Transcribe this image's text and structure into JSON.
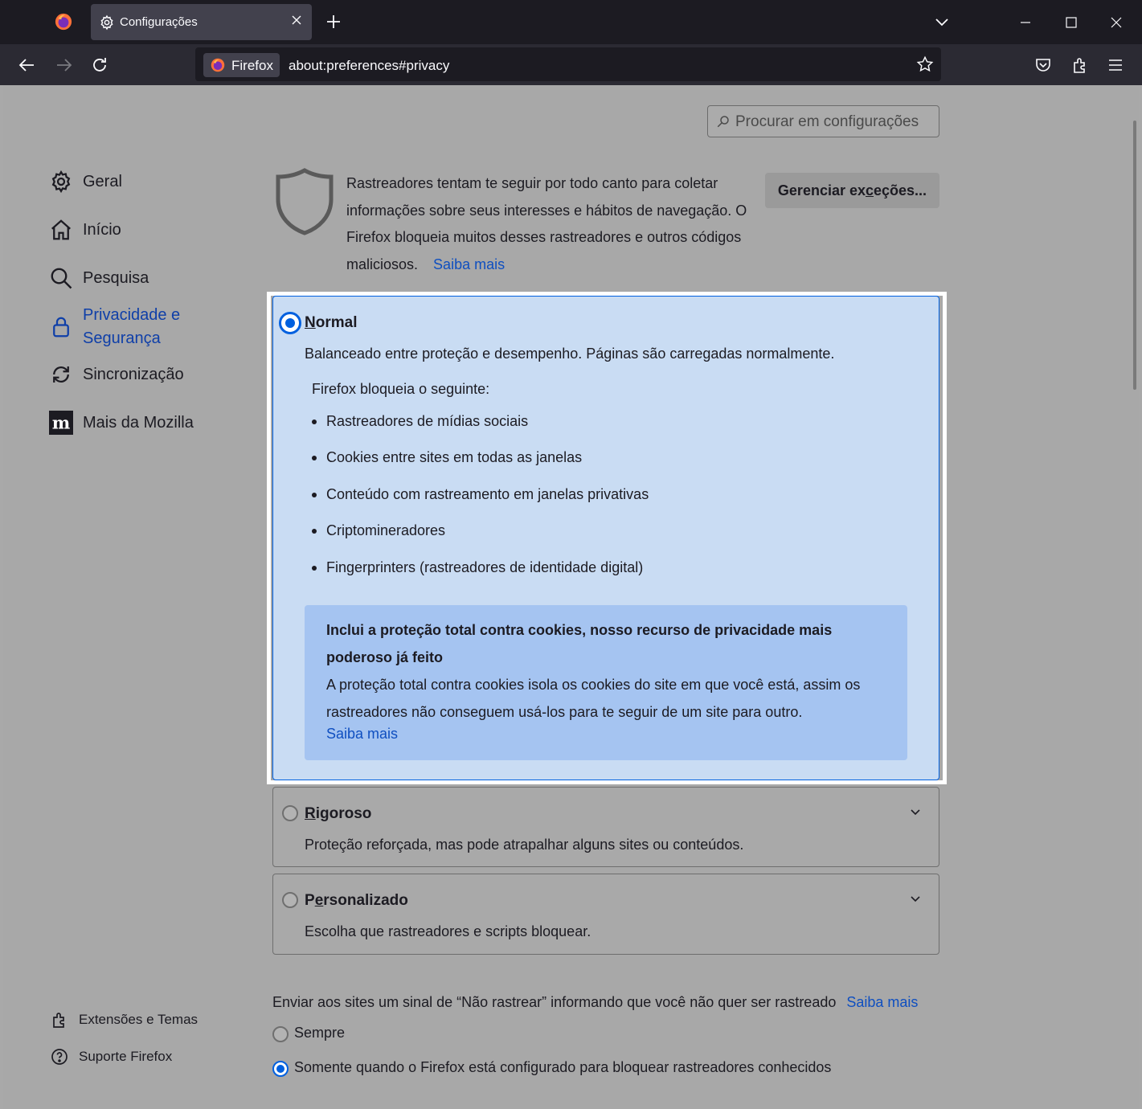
{
  "tab": {
    "title": "Configurações"
  },
  "urlbar": {
    "identity_label": "Firefox",
    "url": "about:preferences#privacy"
  },
  "search": {
    "placeholder": "Procurar em configurações"
  },
  "sidebar": {
    "items": [
      {
        "label": "Geral"
      },
      {
        "label": "Início"
      },
      {
        "label": "Pesquisa"
      },
      {
        "label_line1": "Privacidade e",
        "label_line2": "Segurança"
      },
      {
        "label": "Sincronização"
      },
      {
        "label": "Mais da Mozilla"
      }
    ],
    "footer": [
      {
        "label": "Extensões e Temas"
      },
      {
        "label": "Suporte Firefox"
      }
    ]
  },
  "tracking": {
    "intro": "Rastreadores tentam te seguir por todo canto para coletar informações sobre seus interesses e hábitos de navegação. O Firefox bloqueia muitos desses rastreadores e outros códigos maliciosos.",
    "learn_more": "Saiba mais",
    "manage_label_pre": "Gerenciar ex",
    "manage_label_key": "c",
    "manage_label_post": "eções..."
  },
  "normal": {
    "title_key": "N",
    "title_rest": "ormal",
    "description": "Balanceado entre proteção e desempenho. Páginas são carregadas normalmente.",
    "blocks_heading": "Firefox bloqueia o seguinte:",
    "blocks": [
      "Rastreadores de mídias sociais",
      "Cookies entre sites em todas as janelas",
      "Conteúdo com rastreamento em janelas privativas",
      "Criptomineradores",
      "Fingerprinters (rastreadores de identidade digital)"
    ],
    "tcp_title": "Inclui a proteção total contra cookies, nosso recurso de privacidade mais poderoso já feito",
    "tcp_body": "A proteção total contra cookies isola os cookies do site em que você está, assim os rastreadores não conseguem usá-los para te seguir de um site para outro.",
    "tcp_link": "Saiba mais"
  },
  "strict": {
    "title_key": "R",
    "title_rest": "igoroso",
    "description": "Proteção reforçada, mas pode atrapalhar alguns sites ou conteúdos."
  },
  "custom": {
    "title_pre": "P",
    "title_key": "e",
    "title_rest": "rsonalizado",
    "description": "Escolha que rastreadores e scripts bloquear."
  },
  "dnt": {
    "text": "Enviar aos sites um sinal de “Não rastrear” informando que você não quer ser rastreado",
    "learn_more": "Saiba mais",
    "options": [
      {
        "label": "Sempre",
        "selected": false
      },
      {
        "label": "Somente quando o Firefox está configurado para bloquear rastreadores conhecidos",
        "selected": true
      }
    ]
  },
  "colors": {
    "accent": "#0060df",
    "link": "#0f4fc0",
    "card_bg": "#c9dcf3",
    "tcp_bg": "#a5c4f1"
  }
}
